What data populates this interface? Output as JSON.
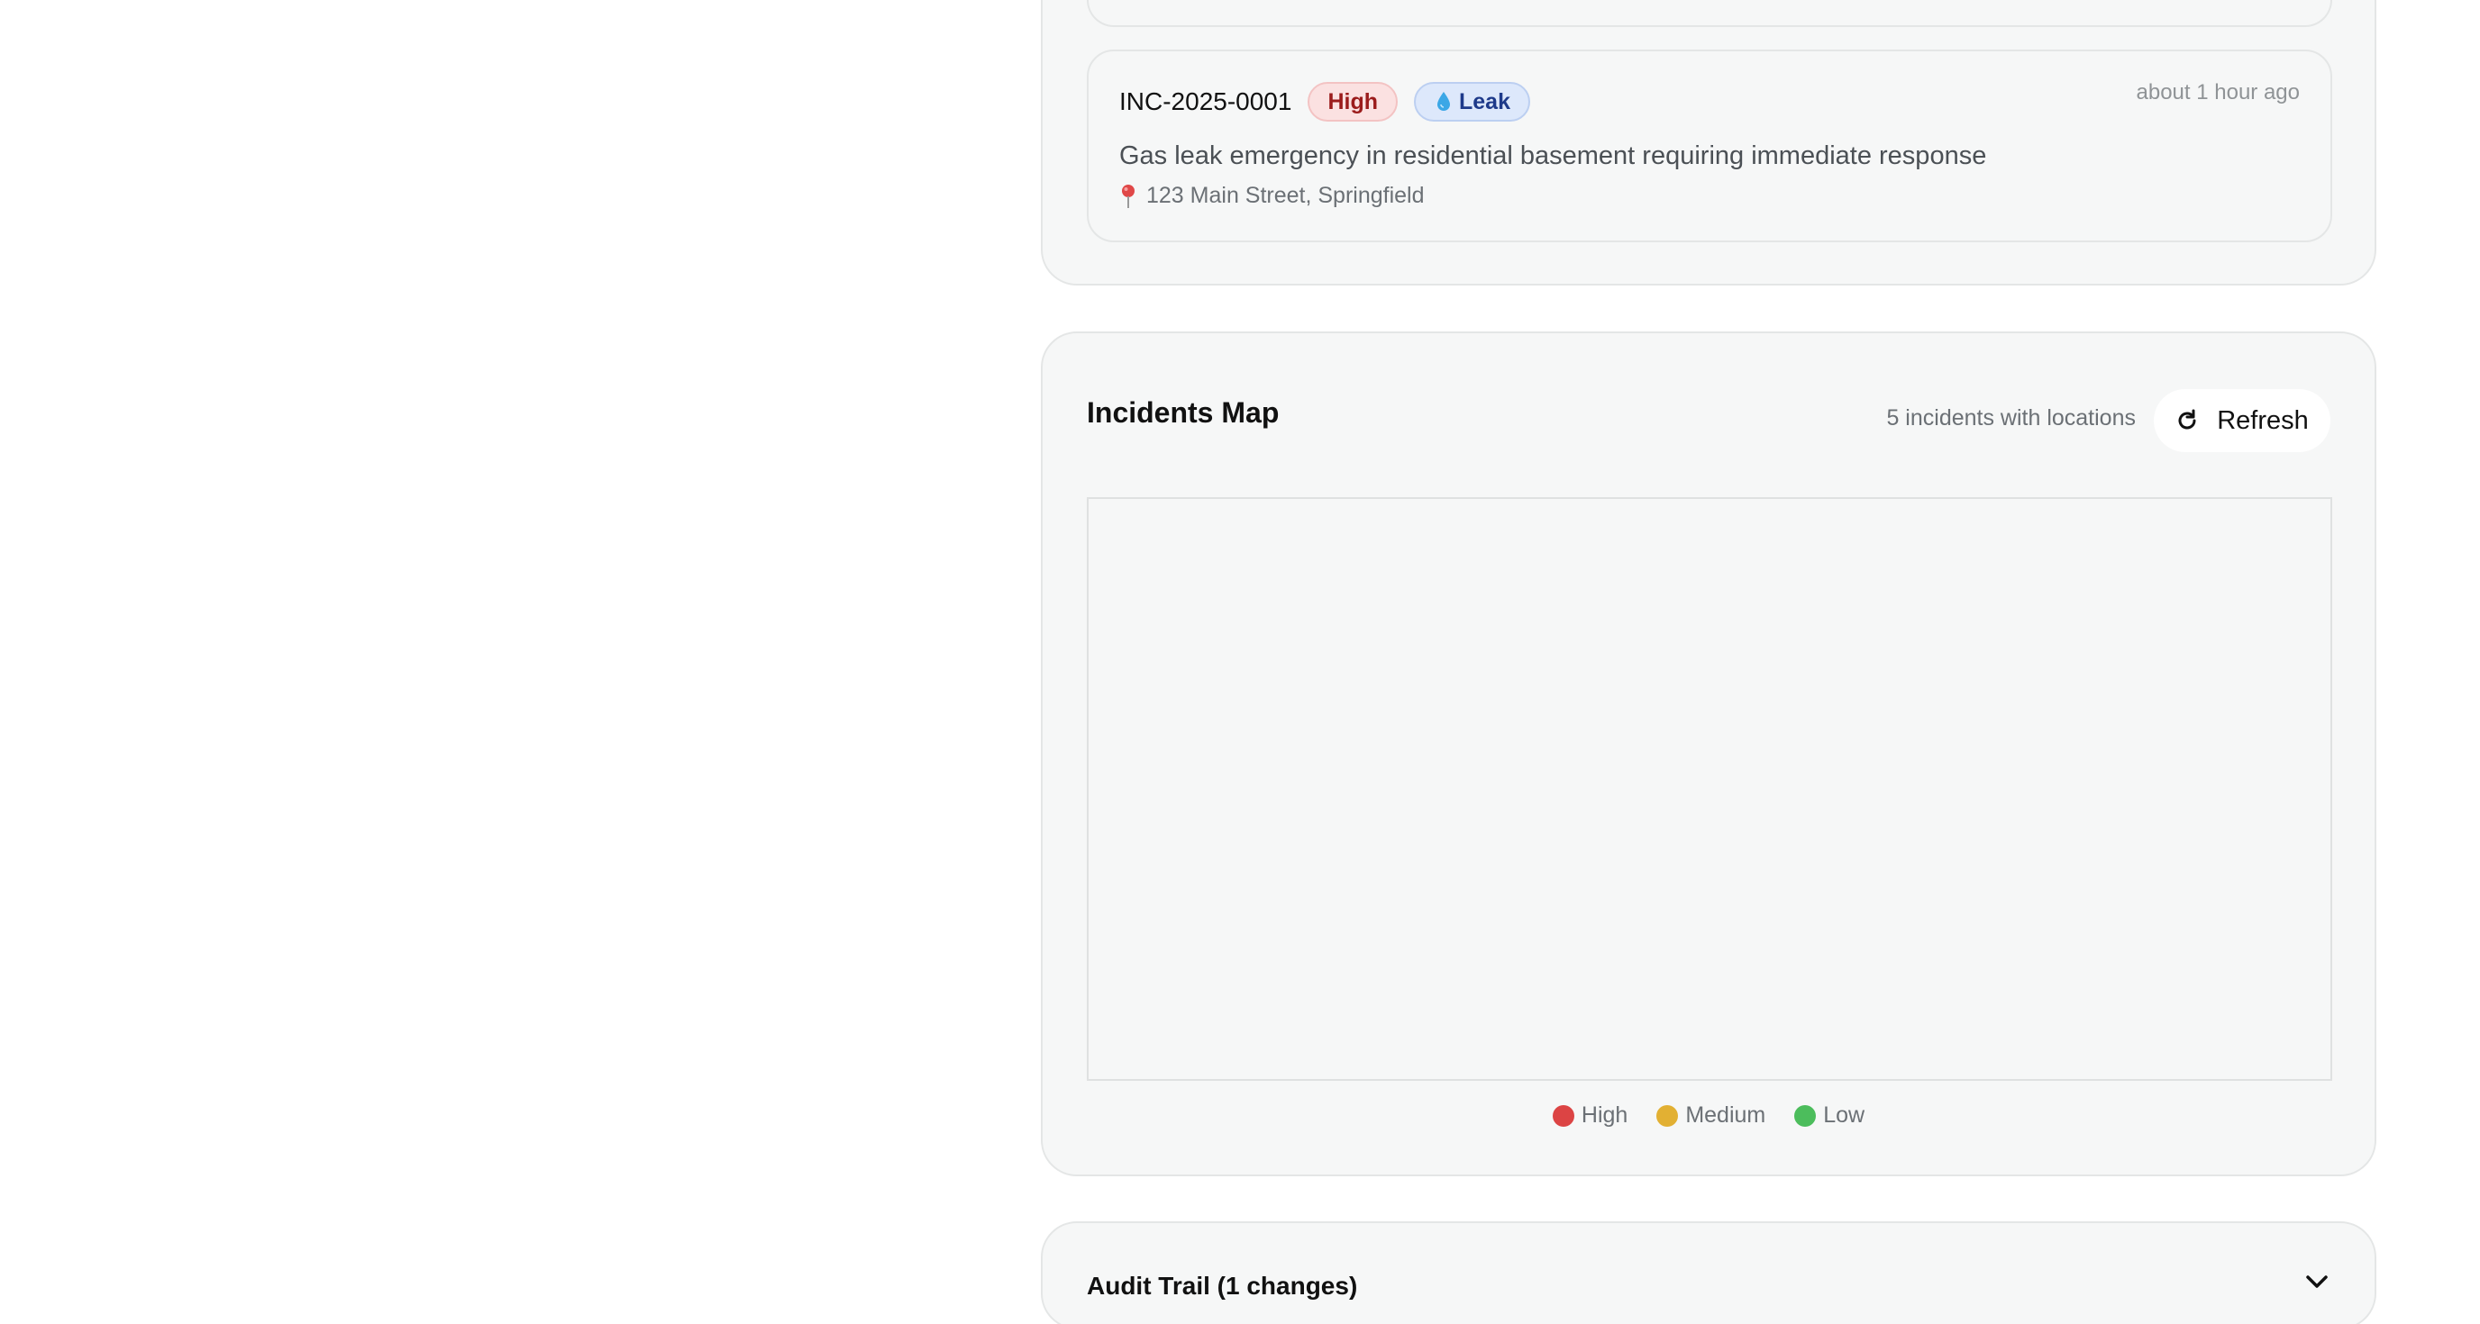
{
  "incident": {
    "id": "INC-2025-0001",
    "severity": "High",
    "type": "Leak",
    "time": "about 1 hour ago",
    "description": "Gas leak emergency in residential basement requiring immediate response",
    "location": "123 Main Street, Springfield",
    "type_icon": "droplet-icon",
    "location_icon": "map-pin-icon"
  },
  "map": {
    "title": "Incidents Map",
    "count_text": "5 incidents with locations",
    "refresh_label": "Refresh",
    "refresh_icon": "refresh-icon",
    "legend": [
      {
        "label": "High",
        "color": "#dc4444"
      },
      {
        "label": "Medium",
        "color": "#e2b033"
      },
      {
        "label": "Low",
        "color": "#4cbd5c"
      }
    ]
  },
  "audit": {
    "title": "Audit Trail (1 changes)",
    "toggle_icon": "chevron-down-icon"
  },
  "colors": {
    "card_bg": "#f6f7f7",
    "border": "#e4e6e6",
    "high_badge_bg": "#fbe1e1",
    "high_badge_text": "#9b1c1c",
    "leak_badge_bg": "#dde8fb",
    "leak_badge_text": "#1e3a8a"
  }
}
